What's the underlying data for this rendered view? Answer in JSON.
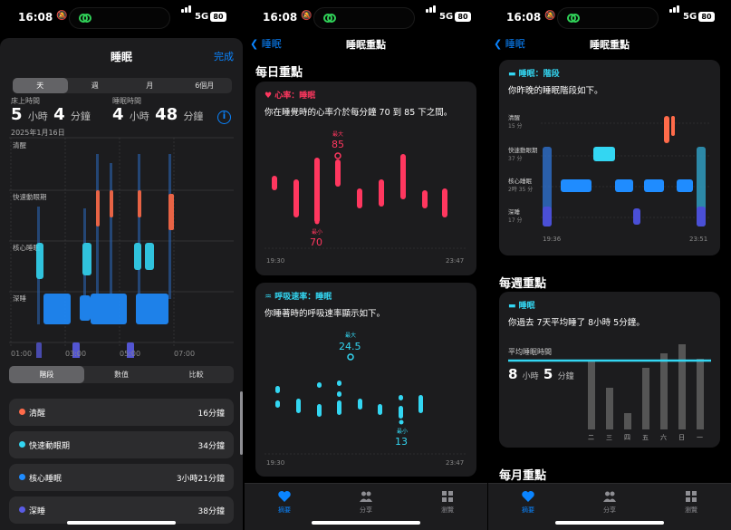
{
  "status": {
    "time": "16:08",
    "network": "5G",
    "battery": "80"
  },
  "panel1": {
    "title": "睡眠",
    "done": "完成",
    "range_tabs": [
      "天",
      "週",
      "月",
      "6個月"
    ],
    "in_bed_label": "床上時間",
    "in_bed_h": "5",
    "in_bed_h_unit": "小時",
    "in_bed_m": "4",
    "in_bed_m_unit": "分鐘",
    "asleep_label": "睡眠時間",
    "asleep_h": "4",
    "asleep_h_unit": "小時",
    "asleep_m": "48",
    "asleep_m_unit": "分鐘",
    "date": "2025年1月16日",
    "stage_labels": [
      "清醒",
      "快速動眼期",
      "核心睡眠",
      "深睡"
    ],
    "time_labels": [
      "01:00",
      "03:00",
      "05:00",
      "07:00"
    ],
    "view_tabs": [
      "階段",
      "數值",
      "比較"
    ],
    "legend": [
      {
        "name": "清醒",
        "value": "16分鐘",
        "color": "#ff6b4a"
      },
      {
        "name": "快速動眼期",
        "value": "34分鐘",
        "color": "#33d6f2"
      },
      {
        "name": "核心睡眠",
        "value": "3小時21分鐘",
        "color": "#1f8cff"
      },
      {
        "name": "深睡",
        "value": "38分鐘",
        "color": "#5a5ce6"
      }
    ]
  },
  "panel2": {
    "back": "睡眠",
    "title": "睡眠重點",
    "section": "每日重點",
    "hr_card": {
      "header": "心率：睡眠",
      "text": "你在睡覺時的心率介於每分鐘 70 到 85 下之間。",
      "max_label": "最大",
      "max_value": "85",
      "min_label": "最小",
      "min_value": "70",
      "x_start": "19:30",
      "x_end": "23:47",
      "color": "#ff375f"
    },
    "resp_card": {
      "header": "呼吸速率：睡眠",
      "text": "你睡著時的呼吸速率顯示如下。",
      "max_label": "最大",
      "max_value": "24.5",
      "min_label": "最小",
      "min_value": "13",
      "x_start": "19:30",
      "x_end": "23:47",
      "color": "#33d6f2"
    }
  },
  "panel3": {
    "back": "睡眠",
    "title": "睡眠重點",
    "stage_card": {
      "header": "睡眠：階段",
      "text": "你昨晚的睡眠階段如下。",
      "stages": [
        {
          "name": "清醒",
          "dur": "15 分"
        },
        {
          "name": "快速動眼期",
          "dur": "37 分"
        },
        {
          "name": "核心睡眠",
          "dur": "2時 35 分"
        },
        {
          "name": "深睡",
          "dur": "17 分"
        }
      ],
      "x_start": "19:36",
      "x_end": "23:51"
    },
    "weekly_section": "每週重點",
    "weekly_card": {
      "header": "睡眠",
      "text": "你過去 7天平均睡了 8小時 5分鐘。",
      "avg_label": "平均睡眠時間",
      "avg_h": "8",
      "avg_h_unit": "小時",
      "avg_m": "5",
      "avg_m_unit": "分鐘",
      "days": [
        "二",
        "三",
        "四",
        "五",
        "六",
        "日",
        "一"
      ]
    },
    "monthly_section": "每月重點"
  },
  "tabs": [
    "摘要",
    "分享",
    "瀏覽"
  ],
  "colors": {
    "accent": "#0a84ff",
    "awake": "#ff6b4a",
    "rem": "#33d6f2",
    "core": "#1f8cff",
    "deep": "#5a5ce6",
    "heart": "#ff375f"
  }
}
